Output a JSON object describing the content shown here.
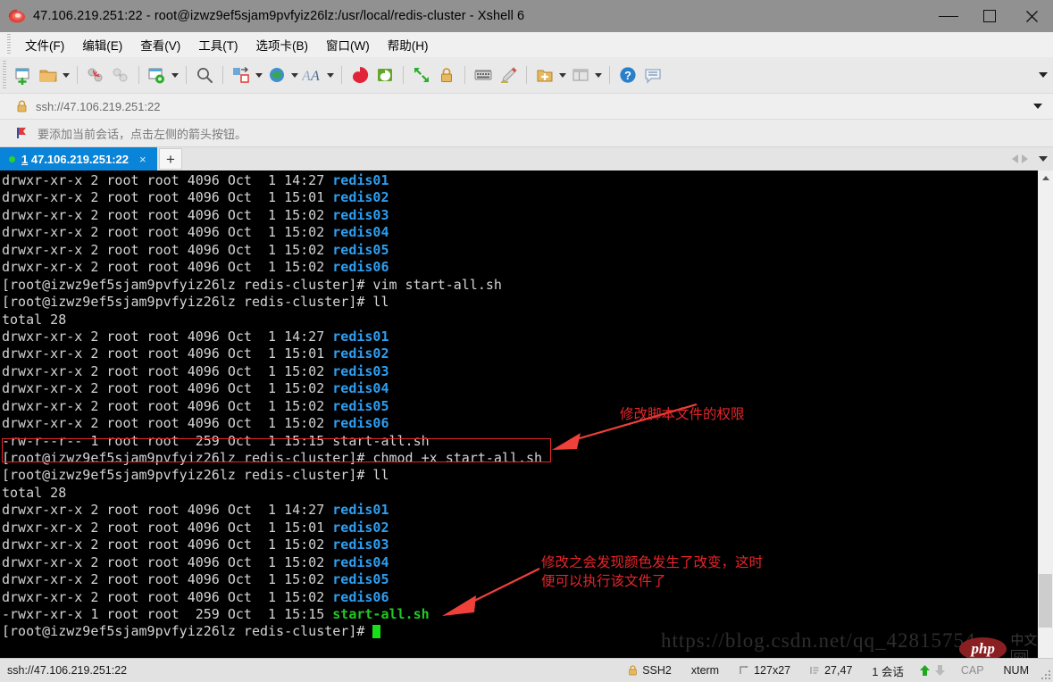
{
  "window": {
    "title": "47.106.219.251:22 - root@izwz9ef5sjam9pvfyiz26lz:/usr/local/redis-cluster - Xshell 6",
    "icon": "xshell-icon",
    "minimize_label": "最小化",
    "maximize_label": "最大化",
    "close_label": "关闭"
  },
  "menubar": {
    "items": [
      {
        "label": "文件(F)",
        "key": "F",
        "name": "menu-file"
      },
      {
        "label": "编辑(E)",
        "key": "E",
        "name": "menu-edit"
      },
      {
        "label": "查看(V)",
        "key": "V",
        "name": "menu-view"
      },
      {
        "label": "工具(T)",
        "key": "T",
        "name": "menu-tools"
      },
      {
        "label": "选项卡(B)",
        "key": "B",
        "name": "menu-tabs"
      },
      {
        "label": "窗口(W)",
        "key": "W",
        "name": "menu-window"
      },
      {
        "label": "帮助(H)",
        "key": "H",
        "name": "menu-help"
      }
    ]
  },
  "toolbar": {
    "buttons": [
      "new-session-icon",
      "open-folder-icon",
      "disconnect-icon",
      "reconnect-icon",
      "session-properties-icon",
      "find-icon",
      "transfer-icon",
      "globe-icon",
      "font-icon",
      "sftp-icon",
      "file-transfer-icon",
      "fullscreen-icon",
      "lock-icon",
      "keyboard-icon",
      "highlight-icon",
      "add-note-icon",
      "layout-icon",
      "help-icon",
      "comment-icon"
    ],
    "overflow": "toolbar-overflow-icon"
  },
  "address_bar": {
    "lock_icon": "lock-icon",
    "value": "ssh://47.106.219.251:22",
    "dropdown": "chevron-down-icon"
  },
  "hint_bar": {
    "flag_icon": "red-flag-icon",
    "text": "要添加当前会话，点击左侧的箭头按钮。"
  },
  "tabs": {
    "items": [
      {
        "number": "1",
        "title": "47.106.219.251:22",
        "status": "connected",
        "close": "×"
      }
    ],
    "new_tab": "+",
    "scroll_left": "◀",
    "scroll_right": "▶",
    "tab_menu": "▼"
  },
  "terminal": {
    "lines": [
      {
        "segs": [
          {
            "t": "drwxr-xr-x 2 root root 4096 Oct  1 14:27 ",
            "c": "norm"
          },
          {
            "t": "redis01",
            "c": "dir"
          }
        ]
      },
      {
        "segs": [
          {
            "t": "drwxr-xr-x 2 root root 4096 Oct  1 15:01 ",
            "c": "norm"
          },
          {
            "t": "redis02",
            "c": "dir"
          }
        ]
      },
      {
        "segs": [
          {
            "t": "drwxr-xr-x 2 root root 4096 Oct  1 15:02 ",
            "c": "norm"
          },
          {
            "t": "redis03",
            "c": "dir"
          }
        ]
      },
      {
        "segs": [
          {
            "t": "drwxr-xr-x 2 root root 4096 Oct  1 15:02 ",
            "c": "norm"
          },
          {
            "t": "redis04",
            "c": "dir"
          }
        ]
      },
      {
        "segs": [
          {
            "t": "drwxr-xr-x 2 root root 4096 Oct  1 15:02 ",
            "c": "norm"
          },
          {
            "t": "redis05",
            "c": "dir"
          }
        ]
      },
      {
        "segs": [
          {
            "t": "drwxr-xr-x 2 root root 4096 Oct  1 15:02 ",
            "c": "norm"
          },
          {
            "t": "redis06",
            "c": "dir"
          }
        ]
      },
      {
        "segs": [
          {
            "t": "[root@izwz9ef5sjam9pvfyiz26lz redis-cluster]# vim start-all.sh",
            "c": "norm"
          }
        ]
      },
      {
        "segs": [
          {
            "t": "[root@izwz9ef5sjam9pvfyiz26lz redis-cluster]# ll",
            "c": "norm"
          }
        ]
      },
      {
        "segs": [
          {
            "t": "total 28",
            "c": "norm"
          }
        ]
      },
      {
        "segs": [
          {
            "t": "drwxr-xr-x 2 root root 4096 Oct  1 14:27 ",
            "c": "norm"
          },
          {
            "t": "redis01",
            "c": "dir"
          }
        ]
      },
      {
        "segs": [
          {
            "t": "drwxr-xr-x 2 root root 4096 Oct  1 15:01 ",
            "c": "norm"
          },
          {
            "t": "redis02",
            "c": "dir"
          }
        ]
      },
      {
        "segs": [
          {
            "t": "drwxr-xr-x 2 root root 4096 Oct  1 15:02 ",
            "c": "norm"
          },
          {
            "t": "redis03",
            "c": "dir"
          }
        ]
      },
      {
        "segs": [
          {
            "t": "drwxr-xr-x 2 root root 4096 Oct  1 15:02 ",
            "c": "norm"
          },
          {
            "t": "redis04",
            "c": "dir"
          }
        ]
      },
      {
        "segs": [
          {
            "t": "drwxr-xr-x 2 root root 4096 Oct  1 15:02 ",
            "c": "norm"
          },
          {
            "t": "redis05",
            "c": "dir"
          }
        ]
      },
      {
        "segs": [
          {
            "t": "drwxr-xr-x 2 root root 4096 Oct  1 15:02 ",
            "c": "norm"
          },
          {
            "t": "redis06",
            "c": "dir"
          }
        ]
      },
      {
        "segs": [
          {
            "t": "-rw-r--r-- 1 root root  259 Oct  1 15:15 start-all.sh",
            "c": "norm"
          }
        ]
      },
      {
        "segs": [
          {
            "t": "[root@izwz9ef5sjam9pvfyiz26lz redis-cluster]# chmod +x start-all.sh",
            "c": "norm"
          }
        ]
      },
      {
        "segs": [
          {
            "t": "[root@izwz9ef5sjam9pvfyiz26lz redis-cluster]# ll",
            "c": "norm"
          }
        ]
      },
      {
        "segs": [
          {
            "t": "total 28",
            "c": "norm"
          }
        ]
      },
      {
        "segs": [
          {
            "t": "drwxr-xr-x 2 root root 4096 Oct  1 14:27 ",
            "c": "norm"
          },
          {
            "t": "redis01",
            "c": "dir"
          }
        ]
      },
      {
        "segs": [
          {
            "t": "drwxr-xr-x 2 root root 4096 Oct  1 15:01 ",
            "c": "norm"
          },
          {
            "t": "redis02",
            "c": "dir"
          }
        ]
      },
      {
        "segs": [
          {
            "t": "drwxr-xr-x 2 root root 4096 Oct  1 15:02 ",
            "c": "norm"
          },
          {
            "t": "redis03",
            "c": "dir"
          }
        ]
      },
      {
        "segs": [
          {
            "t": "drwxr-xr-x 2 root root 4096 Oct  1 15:02 ",
            "c": "norm"
          },
          {
            "t": "redis04",
            "c": "dir"
          }
        ]
      },
      {
        "segs": [
          {
            "t": "drwxr-xr-x 2 root root 4096 Oct  1 15:02 ",
            "c": "norm"
          },
          {
            "t": "redis05",
            "c": "dir"
          }
        ]
      },
      {
        "segs": [
          {
            "t": "drwxr-xr-x 2 root root 4096 Oct  1 15:02 ",
            "c": "norm"
          },
          {
            "t": "redis06",
            "c": "dir"
          }
        ]
      },
      {
        "segs": [
          {
            "t": "-rwxr-xr-x 1 root root  259 Oct  1 15:15 ",
            "c": "norm"
          },
          {
            "t": "start-all.sh",
            "c": "exec"
          }
        ]
      },
      {
        "segs": [
          {
            "t": "[root@izwz9ef5sjam9pvfyiz26lz redis-cluster]# ",
            "c": "norm"
          },
          {
            "t": "",
            "c": "cursor"
          }
        ]
      }
    ],
    "colors": {
      "background": "#000000",
      "foreground": "#d4d4d4",
      "directory": "#2f9ef0",
      "executable": "#23c723",
      "cursor": "#18e018",
      "annotation": "#e8252a"
    }
  },
  "annotations": [
    {
      "name": "annotation-chmod",
      "text": "修改脚本文件的权限"
    },
    {
      "name": "annotation-color-change",
      "text": "修改之会发现颜色发生了改变，这时\n便可以执行该文件了"
    }
  ],
  "watermark": {
    "url": "https://blog.csdn.net/qq_42815754",
    "logo_text": "php",
    "logo_suffix": "中文",
    "logo_boxed": "网"
  },
  "statusbar": {
    "left": "ssh://47.106.219.251:22",
    "protocol": "SSH2",
    "terminal_type": "xterm",
    "size_icon": "resize-icon",
    "size": "127x27",
    "cursor_icon": "cursor-pos-icon",
    "cursor_pos": "27,47",
    "sessions": "1 会话",
    "upload_icon": "upload-arrow-icon",
    "download_icon": "download-arrow-icon",
    "caps": "CAP",
    "num": "NUM"
  }
}
